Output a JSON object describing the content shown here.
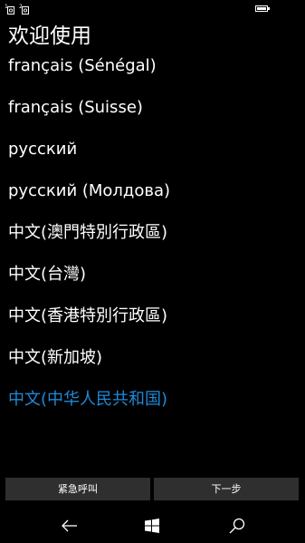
{
  "page": {
    "title": "欢迎使用"
  },
  "status_bar": {
    "icons": [
      "sim1-icon",
      "sim2-icon",
      "battery-icon"
    ]
  },
  "languages": {
    "items": [
      {
        "label": "français (Sénégal)",
        "selected": false
      },
      {
        "label": "français (Suisse)",
        "selected": false
      },
      {
        "label": "русский",
        "selected": false
      },
      {
        "label": "русский (Молдова)",
        "selected": false
      },
      {
        "label": "中文(澳門特別行政區)",
        "selected": false
      },
      {
        "label": "中文(台灣)",
        "selected": false
      },
      {
        "label": "中文(香港特別行政區)",
        "selected": false
      },
      {
        "label": "中文(新加坡)",
        "selected": false
      },
      {
        "label": "中文(中华人民共和国)",
        "selected": true
      }
    ],
    "selected_color": "#1f8ad8"
  },
  "buttons": {
    "emergency_call": "紧急呼叫",
    "next": "下一步"
  },
  "nav": {
    "icons": [
      "back-arrow-icon",
      "windows-start-icon",
      "search-icon"
    ]
  }
}
